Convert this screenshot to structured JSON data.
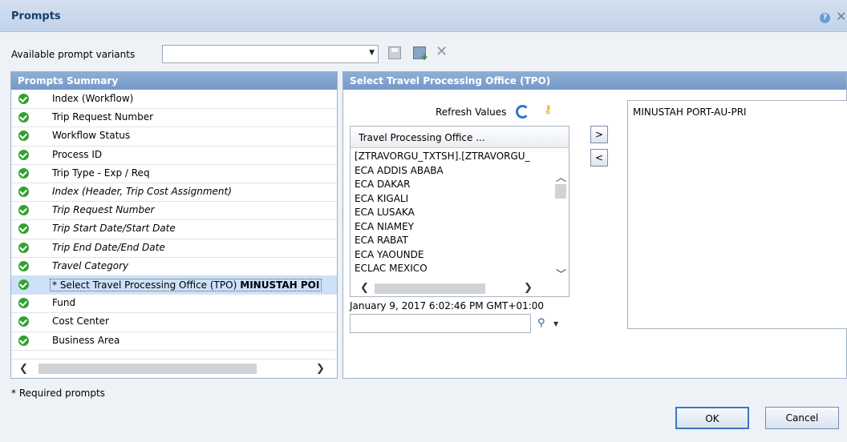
{
  "dialog": {
    "title": "Prompts"
  },
  "variants": {
    "label": "Available prompt variants",
    "value": ""
  },
  "summary": {
    "header": "Prompts Summary",
    "items": [
      {
        "label": "Index (Workflow)",
        "italic": false
      },
      {
        "label": "Trip Request Number",
        "italic": false
      },
      {
        "label": "Workflow Status",
        "italic": false
      },
      {
        "label": "Process ID",
        "italic": false
      },
      {
        "label": "Trip Type - Exp / Req",
        "italic": false
      },
      {
        "label": "Index (Header, Trip Cost Assignment)",
        "italic": true
      },
      {
        "label": "Trip Request Number",
        "italic": true
      },
      {
        "label": "Trip Start Date/Start Date",
        "italic": true
      },
      {
        "label": "Trip End Date/End Date",
        "italic": true
      },
      {
        "label": "Travel Category",
        "italic": true
      },
      {
        "label": "* Select Travel Processing Office (TPO)",
        "value": "MINUSTAH POI",
        "italic": false,
        "selected": true
      },
      {
        "label": "Fund",
        "italic": false
      },
      {
        "label": "Cost Center",
        "italic": false
      },
      {
        "label": "Business Area",
        "italic": false
      }
    ]
  },
  "detail": {
    "header": "Select Travel Processing Office (TPO)",
    "refresh_label": "Refresh Values",
    "column_header": "Travel Processing Office ...",
    "values": [
      "[ZTRAVORGU_TXTSH].[ZTRAVORGU_",
      "ECA ADDIS ABABA",
      "ECA DAKAR",
      "ECA KIGALI",
      "ECA LUSAKA",
      "ECA NIAMEY",
      "ECA RABAT",
      "ECA YAOUNDE",
      "ECLAC MEXICO"
    ],
    "refresh_time": "January 9, 2017 6:02:46 PM GMT+01:00",
    "search_value": "",
    "add_label": ">",
    "remove_label": "<",
    "selected_values": [
      "MINUSTAH PORT-AU-PRI"
    ]
  },
  "footer": {
    "required_note": "* Required prompts",
    "ok_label": "OK",
    "cancel_label": "Cancel"
  }
}
